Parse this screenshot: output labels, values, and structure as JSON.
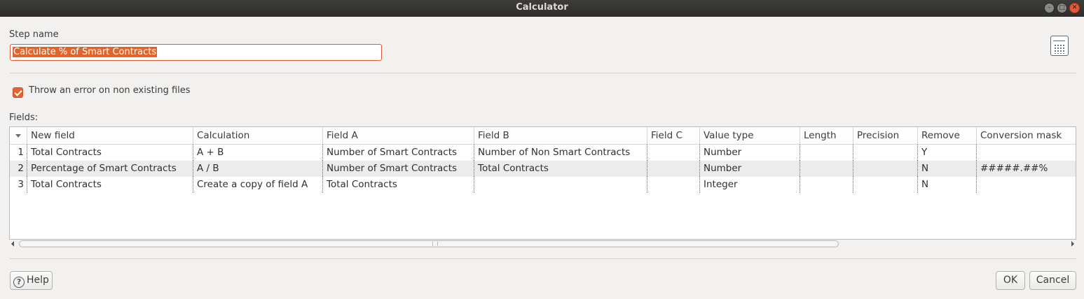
{
  "window": {
    "title": "Calculator"
  },
  "step": {
    "label": "Step name",
    "value": "Calculate % of Smart Contracts"
  },
  "option": {
    "checkbox_label": "Throw an error on non existing files",
    "checked": true
  },
  "fields": {
    "label": "Fields:",
    "columns": [
      "New field",
      "Calculation",
      "Field A",
      "Field B",
      "Field C",
      "Value type",
      "Length",
      "Precision",
      "Remove",
      "Conversion mask"
    ],
    "rows": [
      {
        "idx": "1",
        "new_field": "Total Contracts",
        "calculation": "A + B",
        "field_a": "Number of Smart Contracts",
        "field_b": "Number of Non Smart Contracts",
        "field_c": "",
        "value_type": "Number",
        "length": "",
        "precision": "",
        "remove": "Y",
        "conversion_mask": ""
      },
      {
        "idx": "2",
        "new_field": "Percentage of Smart Contracts",
        "calculation": "A / B",
        "field_a": "Number of Smart Contracts",
        "field_b": "Total Contracts",
        "field_c": "",
        "value_type": "Number",
        "length": "",
        "precision": "",
        "remove": "N",
        "conversion_mask": "#####.##%"
      },
      {
        "idx": "3",
        "new_field": "Total Contracts",
        "calculation": "Create a copy of field A",
        "field_a": "Total Contracts",
        "field_b": "",
        "field_c": "",
        "value_type": "Integer",
        "length": "",
        "precision": "",
        "remove": "N",
        "conversion_mask": ""
      }
    ]
  },
  "buttons": {
    "help": "Help",
    "ok": "OK",
    "cancel": "Cancel"
  },
  "icons": {
    "step_icon": "calculator-icon",
    "help_icon": "question-mark-icon"
  },
  "colors": {
    "accent": "#e2652e",
    "titlebar": "#3d3c39"
  }
}
